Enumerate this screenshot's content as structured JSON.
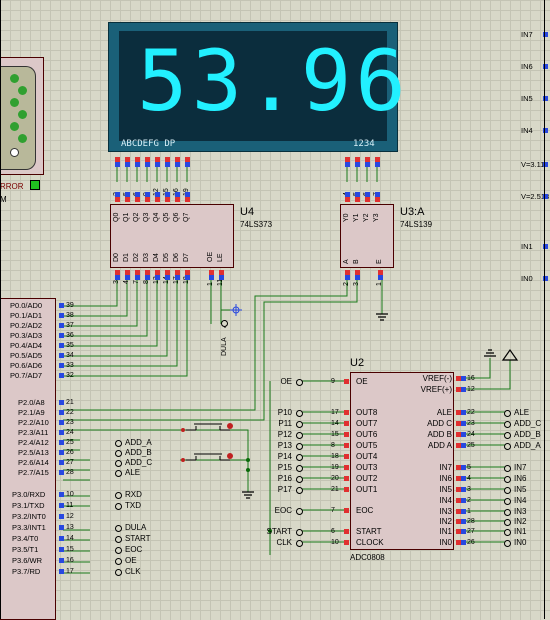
{
  "display": {
    "digits": "53.96",
    "seg_labels": "ABCDEFG  DP",
    "dig_labels": "1234"
  },
  "u4": {
    "ref": "U4",
    "type": "74LS373",
    "q_pins": [
      "Q0",
      "Q1",
      "Q2",
      "Q3",
      "Q4",
      "Q5",
      "Q6",
      "Q7"
    ],
    "d_pins": [
      "D0",
      "D1",
      "D2",
      "D3",
      "D4",
      "D5",
      "D6",
      "D7"
    ],
    "oe": "OE",
    "le": "LE",
    "top_nums": [
      "2",
      "5",
      "6",
      "9",
      "12",
      "15",
      "16",
      "19"
    ],
    "bot_nums": [
      "3",
      "4",
      "7",
      "8",
      "13",
      "14",
      "17",
      "18",
      "1",
      "11"
    ]
  },
  "u3": {
    "ref": "U3:A",
    "type": "74LS139",
    "y_pins": [
      "Y0",
      "Y1",
      "Y2",
      "Y3"
    ],
    "in_pins": [
      "A",
      "B",
      "E"
    ],
    "top_nums": [
      "4",
      "5",
      "6",
      "7"
    ],
    "bot_nums": [
      "2",
      "3",
      "1"
    ]
  },
  "u1": {
    "p0": [
      "P0.0/AD0",
      "P0.1/AD1",
      "P0.2/AD2",
      "P0.3/AD3",
      "P0.4/AD4",
      "P0.5/AD5",
      "P0.6/AD6",
      "P0.7/AD7"
    ],
    "p0_nums": [
      "39",
      "38",
      "37",
      "36",
      "35",
      "34",
      "33",
      "32"
    ],
    "p2": [
      "P2.0/A8",
      "P2.1/A9",
      "P2.2/A10",
      "P2.3/A11",
      "P2.4/A12",
      "P2.5/A13",
      "P2.6/A14",
      "P2.7/A15"
    ],
    "p2_nums": [
      "21",
      "22",
      "23",
      "24",
      "25",
      "26",
      "27",
      "28"
    ],
    "p3": [
      "P3.0/RXD",
      "P3.1/TXD",
      "P3.2/INT0",
      "P3.3/INT1",
      "P3.4/T0",
      "P3.5/T1",
      "P3.6/WR",
      "P3.7/RD"
    ],
    "p3_nums": [
      "10",
      "11",
      "12",
      "13",
      "14",
      "15",
      "16",
      "17"
    ]
  },
  "net_labels": {
    "p2": [
      "ADD_A",
      "ADD_B",
      "ADD_C",
      "ALE"
    ],
    "p3": [
      "RXD",
      "TXD",
      "DULA",
      "START",
      "EOC",
      "OE",
      "CLK"
    ],
    "dula": "DULA"
  },
  "u2": {
    "ref": "U2",
    "type": "ADC0808",
    "left_pins": [
      "OE",
      "OUT8",
      "OUT7",
      "OUT6",
      "OUT5",
      "OUT4",
      "OUT3",
      "OUT2",
      "OUT1",
      "EOC",
      "START",
      "CLOCK"
    ],
    "left_nums": [
      "9",
      "17",
      "14",
      "15",
      "8",
      "18",
      "19",
      "20",
      "21",
      "7",
      "6",
      "10"
    ],
    "left_nets": [
      "OE",
      "P10",
      "P11",
      "P12",
      "P13",
      "P14",
      "P15",
      "P16",
      "P17",
      "EOC",
      "START",
      "CLK"
    ],
    "right_pins": [
      "VREF(-)",
      "VREF(+)",
      "ALE",
      "ADD C",
      "ADD B",
      "ADD A",
      "IN7",
      "IN6",
      "IN5",
      "IN4",
      "IN3",
      "IN2",
      "IN1",
      "IN0"
    ],
    "right_nums": [
      "16",
      "12",
      "22",
      "23",
      "24",
      "25",
      "5",
      "4",
      "3",
      "2",
      "1",
      "28",
      "27",
      "26"
    ],
    "right_nets": [
      "ALE",
      "ADD_C",
      "ADD_B",
      "ADD_A",
      "IN7",
      "IN6",
      "IN5",
      "IN4",
      "IN3",
      "IN2",
      "IN1",
      "IN0"
    ]
  },
  "right_edge": [
    "IN7",
    "IN6",
    "IN5",
    "IN4",
    "V=3.11",
    "V=2.513",
    "IN1",
    "IN0"
  ],
  "connector": {
    "error": "RROR",
    "m": "M"
  }
}
